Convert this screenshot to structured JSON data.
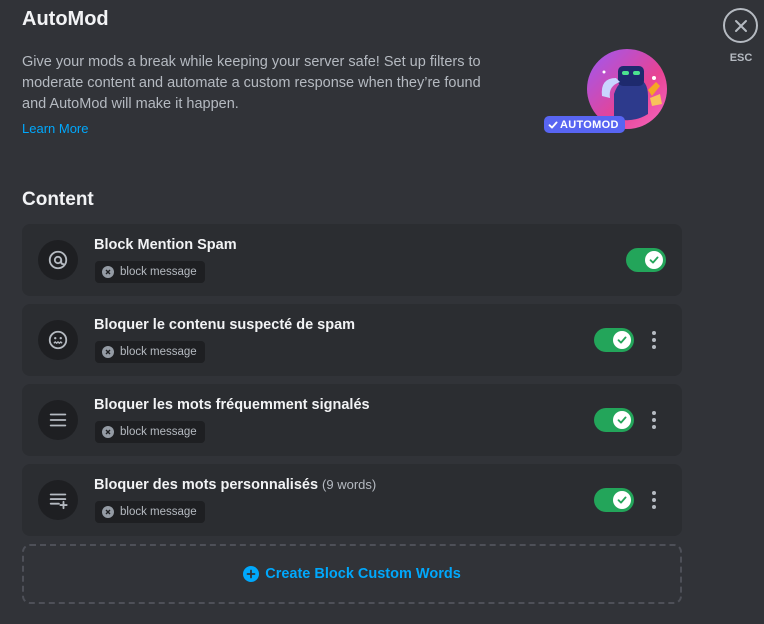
{
  "header": {
    "title": "AutoMod",
    "description": "Give your mods a break while keeping your server safe! Set up filters to moderate content and automate a custom response when they’re found and AutoMod will make it happen.",
    "learn_more": "Learn More",
    "badge": "AUTOMOD",
    "close_label": "ESC"
  },
  "section": {
    "title": "Content"
  },
  "rules": [
    {
      "name": "Block Mention Spam",
      "count": "",
      "action": "block message",
      "enabled": true,
      "icon": "at-sign-icon",
      "has_menu": false
    },
    {
      "name": "Bloquer le contenu suspecté de spam",
      "count": "",
      "action": "block message",
      "enabled": true,
      "icon": "spam-face-icon",
      "has_menu": true
    },
    {
      "name": "Bloquer les mots fréquemment signalés",
      "count": "",
      "action": "block message",
      "enabled": true,
      "icon": "list-lines-icon",
      "has_menu": true
    },
    {
      "name": "Bloquer des mots personnalisés",
      "count": "(9 words)",
      "action": "block message",
      "enabled": true,
      "icon": "list-add-icon",
      "has_menu": true
    }
  ],
  "create": {
    "label": "Create Block Custom Words",
    "icon": "plus-circle-icon"
  },
  "colors": {
    "background": "#313338",
    "card": "#2b2d31",
    "toggle_on": "#23a55a",
    "link": "#00a8fc",
    "brand": "#5865f2"
  }
}
